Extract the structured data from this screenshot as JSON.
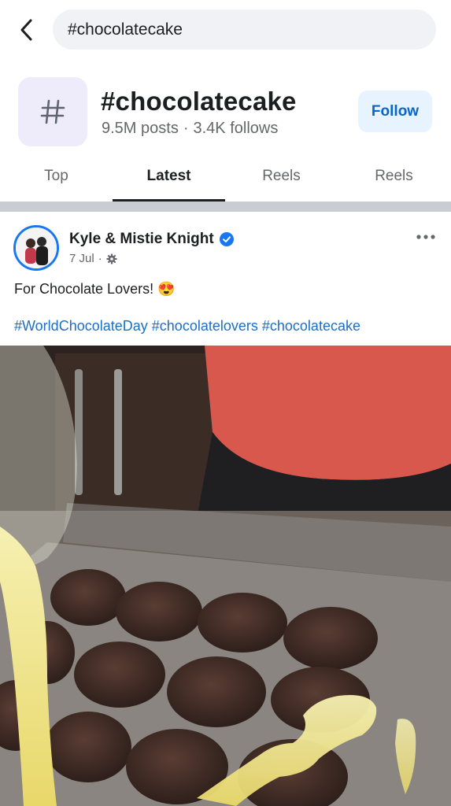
{
  "search": {
    "query": "#chocolatecake"
  },
  "header": {
    "tag_symbol": "#",
    "title": "#chocolatecake",
    "posts": "9.5M posts",
    "separator": "·",
    "follows": "3.4K follows",
    "follow_label": "Follow"
  },
  "tabs": [
    {
      "label": "Top",
      "active": false
    },
    {
      "label": "Latest",
      "active": true
    },
    {
      "label": "Reels",
      "active": false
    },
    {
      "label": "Reels",
      "active": false
    }
  ],
  "post": {
    "author": "Kyle & Mistie Knight",
    "verified": true,
    "date": "7 Jul",
    "dot": "·",
    "audience_icon": "gear-icon",
    "caption": "For Chocolate Lovers! 😍",
    "hashtags": [
      "#WorldChocolateDay",
      "#chocolatelovers",
      "#chocolatecake"
    ],
    "media_description_icon": "photo-image"
  },
  "colors": {
    "accent": "#1877f2",
    "link": "#1c6fc4",
    "follow_bg": "#e7f3ff"
  }
}
